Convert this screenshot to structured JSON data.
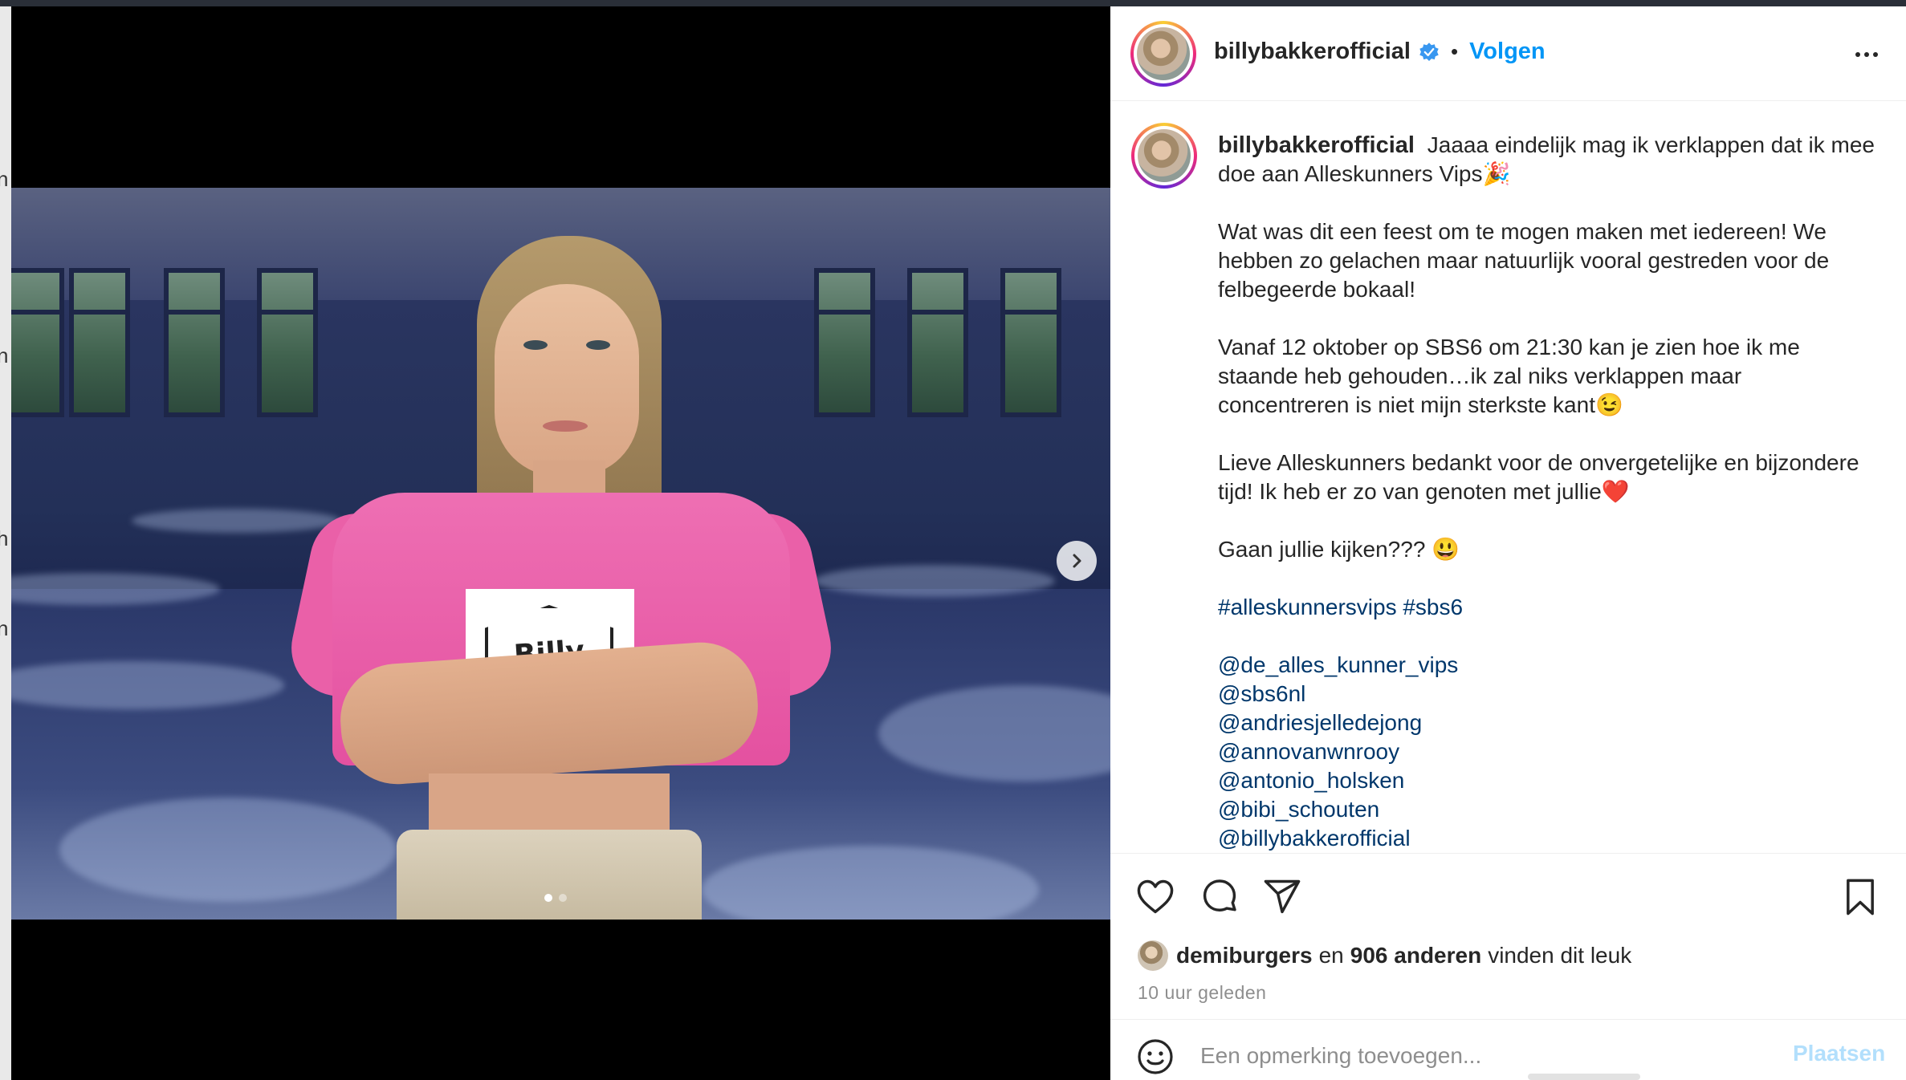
{
  "post": {
    "username": "billybakkerofficial",
    "separator": "•",
    "follow_label": "Volgen",
    "caption": {
      "intro": "Jaaaa eindelijk mag ik verklappen dat ik mee doe aan Alleskunners Vips🎉",
      "p2": "Wat was dit een feest om te mogen maken met iedereen! We hebben zo gelachen maar natuurlijk vooral gestreden voor de felbegeerde bokaal!",
      "p3": "Vanaf 12 oktober op SBS6 om 21:30 kan je zien hoe ik me staande heb gehouden…ik zal niks verklappen maar concentreren is niet mijn sterkste kant😉",
      "p4": "Lieve Alleskunners bedankt voor de onvergetelijke en bijzondere tijd! Ik heb er zo van genoten met jullie❤️",
      "p5": "Gaan jullie kijken??? 😃",
      "hashtags": "#alleskunnersvips #sbs6",
      "mentions": [
        "@de_alles_kunner_vips",
        "@sbs6nl",
        "@andriesjelledejong",
        "@annovanwnrooy",
        "@antonio_holsken",
        "@bibi_schouten",
        "@billybakkerofficial"
      ]
    },
    "image_text": "Billy",
    "likes": {
      "first_liker": "demiburgers",
      "connector": "en",
      "others": "906 anderen",
      "suffix": "vinden dit leuk"
    },
    "timestamp": "10 uur geleden",
    "comment": {
      "placeholder": "Een opmerking toevoegen...",
      "post_label": "Plaatsen"
    },
    "carousel": {
      "total": 2,
      "current": 1
    }
  },
  "icons": {
    "verified": "verified-badge-icon",
    "more": "more-options-icon",
    "next": "chevron-right-icon",
    "like": "heart-icon",
    "comment": "comment-bubble-icon",
    "share": "paper-plane-icon",
    "save": "bookmark-icon",
    "emoji": "smiley-icon"
  },
  "colors": {
    "accent": "#0095f6",
    "link": "#00376b",
    "muted": "#8e8e8e",
    "post_disabled": "#b2dffc"
  },
  "backdrop_fragments": [
    "n",
    "n",
    "h",
    "n"
  ]
}
